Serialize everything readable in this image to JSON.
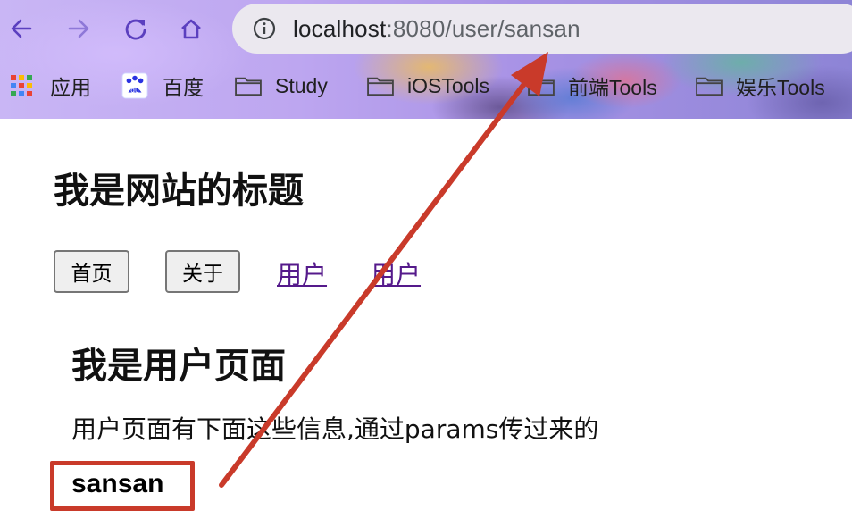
{
  "browser": {
    "url_host": "localhost",
    "url_rest": ":8080/user/sansan",
    "bookmarks": [
      {
        "label": "应用",
        "icon": "apps-grid-icon"
      },
      {
        "label": "百度",
        "icon": "baidu-icon"
      },
      {
        "label": "Study",
        "icon": "folder-icon"
      },
      {
        "label": "iOSTools",
        "icon": "folder-icon"
      },
      {
        "label": "前端Tools",
        "icon": "folder-icon"
      },
      {
        "label": "娱乐Tools",
        "icon": "folder-icon"
      }
    ],
    "nav_icons": [
      "back-arrow-icon",
      "forward-arrow-icon",
      "reload-icon",
      "home-icon",
      "site-info-icon"
    ]
  },
  "page": {
    "site_title": "我是网站的标题",
    "nav": {
      "home_button": "首页",
      "about_button": "关于",
      "user_link_1": "用户",
      "user_link_2": "用户"
    },
    "user_title": "我是用户页面",
    "user_desc": "用户页面有下面这些信息,通过params传过来的",
    "username": "sansan"
  },
  "colors": {
    "link_visited": "#551a8b",
    "annotation_red": "#c93a2a",
    "nav_icon_purple": "#5b3fbf"
  }
}
